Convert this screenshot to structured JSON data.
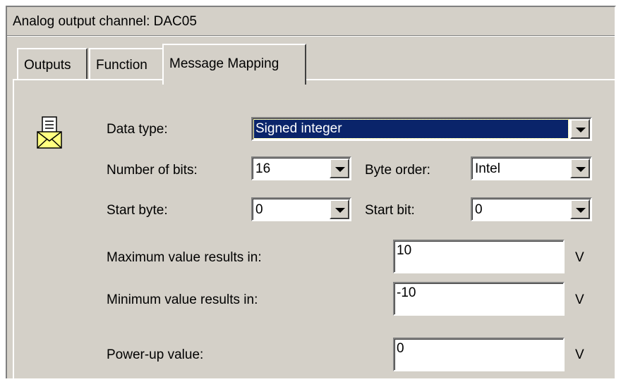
{
  "window": {
    "title": "Analog output channel: DAC05"
  },
  "tabs": [
    {
      "label": "Outputs",
      "active": false
    },
    {
      "label": "Function",
      "active": false
    },
    {
      "label": "Message Mapping",
      "active": true
    }
  ],
  "form": {
    "data_type": {
      "label": "Data type:",
      "value": "Signed integer"
    },
    "number_of_bits": {
      "label": "Number of bits:",
      "value": "16"
    },
    "byte_order": {
      "label": "Byte order:",
      "value": "Intel"
    },
    "start_byte": {
      "label": "Start byte:",
      "value": "0"
    },
    "start_bit": {
      "label": "Start bit:",
      "value": "0"
    },
    "max_value": {
      "label": "Maximum value results in:",
      "value": "10",
      "unit": "V"
    },
    "min_value": {
      "label": "Minimum value results in:",
      "value": "-10",
      "unit": "V"
    },
    "power_up": {
      "label": "Power-up value:",
      "value": "0",
      "unit": "V"
    }
  },
  "icons": {
    "message": "envelope-document-icon"
  },
  "colors": {
    "selection": "#0a246a",
    "face": "#d4d0c8"
  }
}
